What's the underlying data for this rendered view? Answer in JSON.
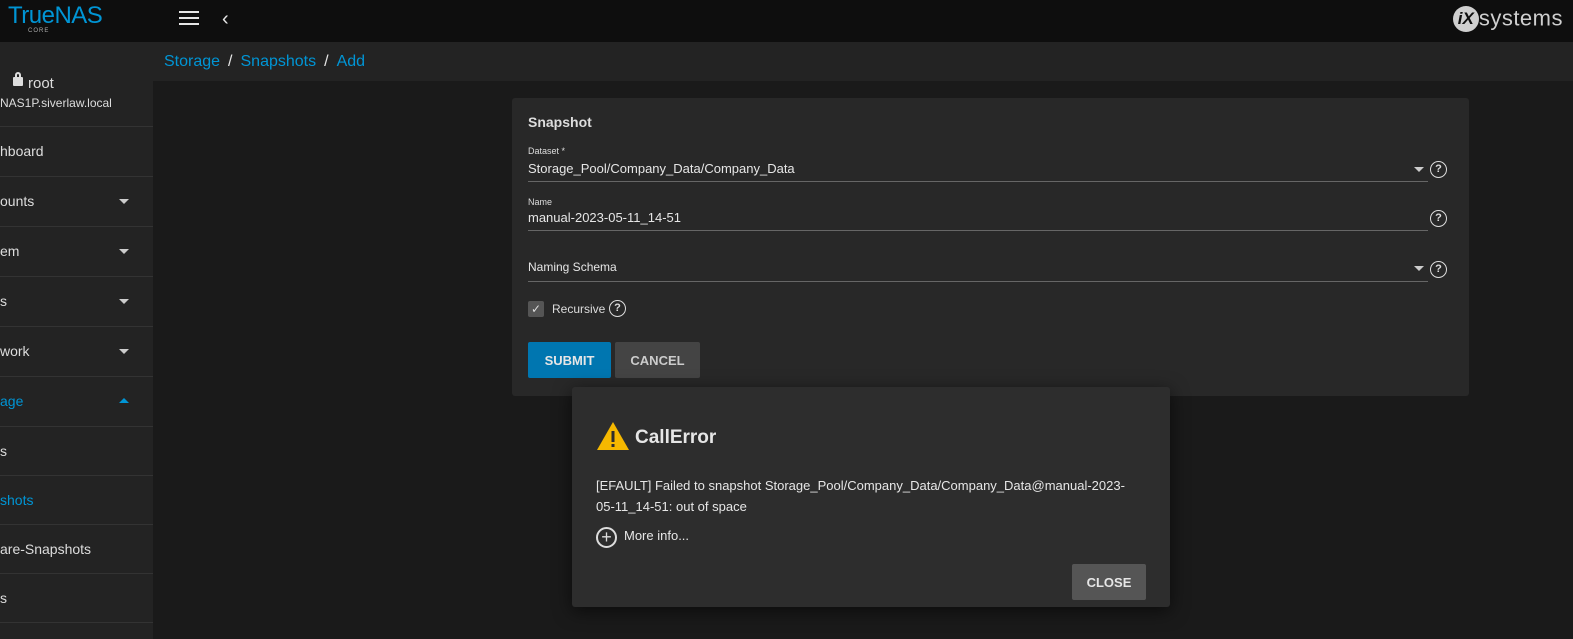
{
  "topbar": {
    "logo": "TrueNAS",
    "logo_sub": "CORE",
    "brand": "systems",
    "brand_mark": "iX"
  },
  "sidebar": {
    "user": "root",
    "host": "NAS1P.siverlaw.local",
    "items": [
      {
        "label": "hboard"
      },
      {
        "label": "ounts"
      },
      {
        "label": "em"
      },
      {
        "label": "s"
      },
      {
        "label": "work"
      },
      {
        "label": "age"
      }
    ],
    "sub_items": [
      {
        "label": "s"
      },
      {
        "label": "shots"
      },
      {
        "label": "are-Snapshots"
      },
      {
        "label": "s"
      }
    ]
  },
  "breadcrumb": [
    "Storage",
    "Snapshots",
    "Add"
  ],
  "form": {
    "title": "Snapshot",
    "dataset_label": "Dataset *",
    "dataset_value": "Storage_Pool/Company_Data/Company_Data",
    "name_label": "Name",
    "name_value": "manual-2023-05-11_14-51",
    "schema_label": "Naming Schema",
    "recursive_label": "Recursive",
    "submit_label": "SUBMIT",
    "cancel_label": "CANCEL"
  },
  "dialog": {
    "title": "CallError",
    "message": "[EFAULT] Failed to snapshot Storage_Pool/Company_Data/Company_Data@manual-2023-05-11_14-51: out of space",
    "more_info": "More info...",
    "close_label": "CLOSE"
  },
  "colors": {
    "accent": "#0095d5",
    "warning": "#f5b800"
  }
}
